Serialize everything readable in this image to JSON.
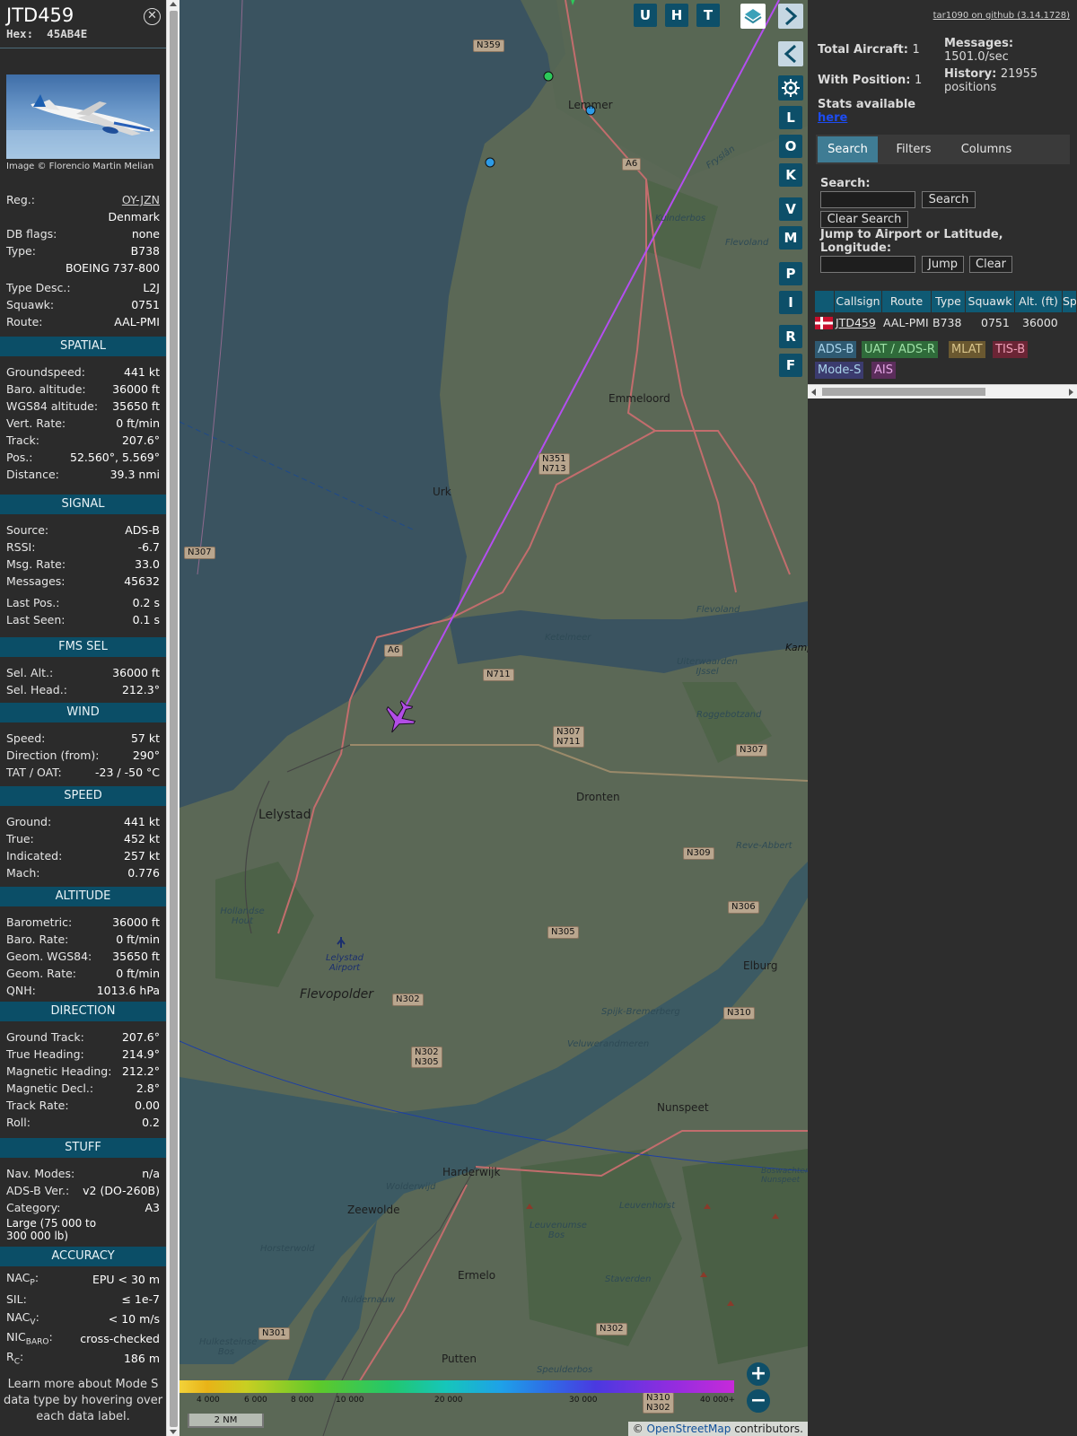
{
  "aircraft": {
    "callsign": "JTD459",
    "hex_label": "Hex:",
    "hex": "45AB4E",
    "photo_credit": "Image © Florencio Martin Melian",
    "details": [
      {
        "label": "Reg.:",
        "value": "OY-JZN"
      },
      {
        "label": "",
        "value": "Denmark"
      },
      {
        "label": "DB flags:",
        "value": "none"
      },
      {
        "label": "Type:",
        "value": "B738"
      },
      {
        "label": "",
        "value": "BOEING 737-800"
      },
      {
        "label": "Type Desc.:",
        "value": "L2J"
      },
      {
        "label": "Squawk:",
        "value": "0751"
      },
      {
        "label": "Route:",
        "value": "AAL-PMI"
      }
    ],
    "sections": [
      {
        "title": "SPATIAL",
        "rows": [
          {
            "label": "Groundspeed:",
            "value": "441 kt"
          },
          {
            "label": "Baro. altitude:",
            "value": "36000 ft"
          },
          {
            "label": "WGS84 altitude:",
            "value": "35650 ft"
          },
          {
            "label": "Vert. Rate:",
            "value": "0 ft/min"
          },
          {
            "label": "Track:",
            "value": "207.6°"
          },
          {
            "label": "Pos.:",
            "value": "52.560°, 5.569°"
          },
          {
            "label": "Distance:",
            "value": "39.3 nmi"
          }
        ]
      },
      {
        "title": "SIGNAL",
        "rows": [
          {
            "label": "Source:",
            "value": "ADS-B"
          },
          {
            "label": "RSSI:",
            "value": "-6.7"
          },
          {
            "label": "Msg. Rate:",
            "value": "33.0"
          },
          {
            "label": "Messages:",
            "value": "45632"
          },
          {
            "label": "Last Pos.:",
            "value": "0.2 s"
          },
          {
            "label": "Last Seen:",
            "value": "0.1 s"
          }
        ]
      },
      {
        "title": "FMS SEL",
        "rows": [
          {
            "label": "Sel. Alt.:",
            "value": "36000 ft"
          },
          {
            "label": "Sel. Head.:",
            "value": "212.3°"
          }
        ]
      },
      {
        "title": "WIND",
        "rows": [
          {
            "label": "Speed:",
            "value": "57 kt"
          },
          {
            "label": "Direction (from):",
            "value": "290°"
          },
          {
            "label": "TAT / OAT:",
            "value": "-23 / -50 °C"
          }
        ]
      },
      {
        "title": "SPEED",
        "rows": [
          {
            "label": "Ground:",
            "value": "441 kt"
          },
          {
            "label": "True:",
            "value": "452 kt"
          },
          {
            "label": "Indicated:",
            "value": "257 kt"
          },
          {
            "label": "Mach:",
            "value": "0.776"
          }
        ]
      },
      {
        "title": "ALTITUDE",
        "rows": [
          {
            "label": "Barometric:",
            "value": "36000 ft"
          },
          {
            "label": "Baro. Rate:",
            "value": "0 ft/min"
          },
          {
            "label": "Geom. WGS84:",
            "value": "35650 ft"
          },
          {
            "label": "Geom. Rate:",
            "value": "0 ft/min"
          },
          {
            "label": "QNH:",
            "value": "1013.6 hPa"
          }
        ]
      },
      {
        "title": "DIRECTION",
        "rows": [
          {
            "label": "Ground Track:",
            "value": "207.6°"
          },
          {
            "label": "True Heading:",
            "value": "214.9°"
          },
          {
            "label": "Magnetic Heading:",
            "value": "212.2°"
          },
          {
            "label": "Magnetic Decl.:",
            "value": "2.8°"
          },
          {
            "label": "Track Rate:",
            "value": "0.00"
          },
          {
            "label": "Roll:",
            "value": "0.2"
          }
        ]
      },
      {
        "title": "STUFF",
        "rows": [
          {
            "label": "Nav. Modes:",
            "value": "n/a"
          },
          {
            "label": "ADS-B Ver.:",
            "value": "v2 (DO-260B)"
          },
          {
            "label": "Category:",
            "value": "A3"
          }
        ]
      },
      {
        "title": "ACCURACY",
        "rows": [
          {
            "label": "NAC",
            "sub": "P",
            "value": "EPU < 30 m"
          },
          {
            "label": "SIL:",
            "value": "≤ 1e-7"
          },
          {
            "label": "NAC",
            "sub": "V",
            "value": "< 10 m/s"
          },
          {
            "label": "NIC",
            "sub": "BARO",
            "value": "cross-checked"
          },
          {
            "label": "R",
            "sub": "C",
            "value": "186 m"
          }
        ]
      }
    ],
    "category_desc": "Large (75 000 to 300 000 lb)",
    "note": "Learn more about Mode S data type by hovering over each data label."
  },
  "map": {
    "buttons": [
      "U",
      "H",
      "T"
    ],
    "side_buttons": [
      "L",
      "O",
      "K",
      "V",
      "M",
      "P",
      "I",
      "R",
      "F"
    ],
    "places": [
      "Lemmer",
      "Emmeloord",
      "Urk",
      "Lelystad",
      "Dronten",
      "Ketelmeer",
      "Uiterwaarden IJssel",
      "Flevopolder",
      "Lelystad Airport",
      "Elburg",
      "Nunspeet",
      "Harderwijk",
      "Zeewolde",
      "Ermelo",
      "Putten",
      "Horsterwold",
      "Veluwerandmeren",
      "Kuinderbos",
      "Flevoland",
      "Roggebotzand",
      "Reve-Abbert",
      "Hollandse Hout",
      "Spijk-Bremerberg",
      "Leuvenumse Bos",
      "Leuvenhorst",
      "Staverden",
      "Speulderbos",
      "Nuldernauw",
      "Wolderwijd",
      "Hulkesteinse Bos",
      "Kamp",
      "Fryslân",
      "Boswachterij Nunspeet"
    ],
    "roads": [
      "N359",
      "A6",
      "N351",
      "N713",
      "N307",
      "N711",
      "N309",
      "N306",
      "N305",
      "N302",
      "N310",
      "N301"
    ],
    "altitude_scale": [
      "4 000",
      "6 000",
      "8 000",
      "10 000",
      "20 000",
      "30 000",
      "40 000+"
    ],
    "scale": "2 NM",
    "attribution_prefix": "© ",
    "attribution_link": "OpenStreetMap",
    "attribution_suffix": " contributors."
  },
  "sidebar": {
    "github": "tar1090 on github (3.14.1728)",
    "total_aircraft_label": "Total Aircraft:",
    "total_aircraft": "1",
    "with_position_label": "With Position:",
    "with_position": "1",
    "messages_label": "Messages:",
    "messages": "1501.0/sec",
    "history_label": "History:",
    "history": "21955 positions",
    "stats_label": "Stats available",
    "stats_link": "here",
    "tabs": [
      "Search",
      "Filters",
      "Columns"
    ],
    "search_label": "Search:",
    "search_value": "",
    "search_button": "Search",
    "clear_search_button": "Clear Search",
    "jump_label": "Jump to Airport or Latitude, Longitude:",
    "jump_value": "",
    "jump_button": "Jump",
    "clear_button": "Clear",
    "table_headers": [
      "Callsign",
      "Route",
      "Type",
      "Squawk",
      "Alt. (ft)",
      "Sp"
    ],
    "table_rows": [
      {
        "callsign": "JTD459",
        "route": "AAL-PMI",
        "type": "B738",
        "squawk": "0751",
        "alt": "36000"
      }
    ],
    "legend": [
      {
        "label": "ADS-B",
        "color": "#2f5a72"
      },
      {
        "label": "UAT / ADS-R",
        "color": "#2f6b3a"
      },
      {
        "label": "MLAT",
        "color": "#6a5830"
      },
      {
        "label": "TIS-B",
        "color": "#6b2535"
      },
      {
        "label": "Mode-S",
        "color": "#3b3b6e"
      },
      {
        "label": "AIS",
        "color": "#5b2d5b"
      }
    ]
  }
}
